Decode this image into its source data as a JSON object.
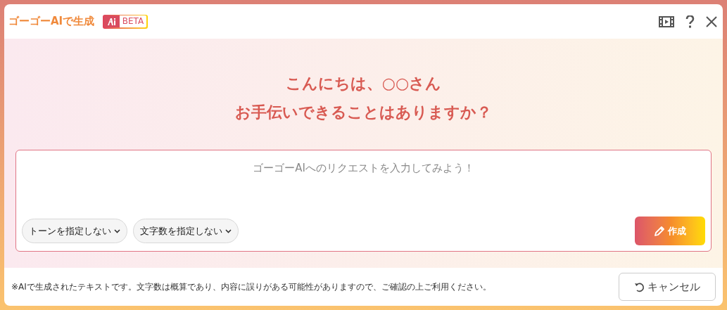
{
  "window": {
    "title": "ゴーゴーAIで生成",
    "badge": "BETA"
  },
  "toolbar": [
    {
      "kind": "video"
    },
    {
      "kind": "help"
    },
    {
      "kind": "close"
    }
  ],
  "greeting": [
    "こんにちは、○○さん",
    "お手伝いできることはありますか？"
  ],
  "request": {
    "placeholder": "ゴーゴーAIへのリクエストを入力してみよう！"
  },
  "options": [
    {
      "label": "トーンを指定しない"
    },
    {
      "label": "文字数を指定しない"
    }
  ],
  "create_button": "作成",
  "footer": {
    "note": "※AIで生成されたテキストです。文字数は概算であり、内容に誤りがある可能性がありますので、ご確認の上ご利用ください。",
    "cancel_button": "キャンセル"
  }
}
